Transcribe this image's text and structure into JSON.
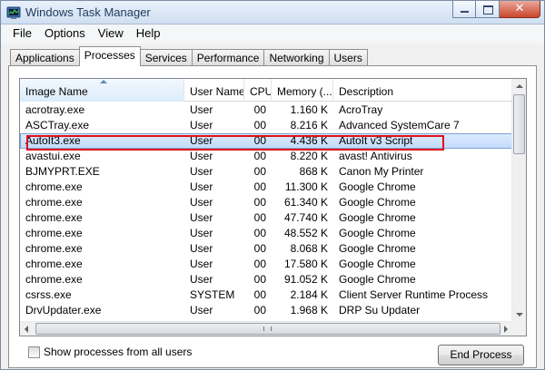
{
  "window": {
    "title": "Windows Task Manager",
    "icon": "task-manager-icon"
  },
  "menu": [
    "File",
    "Options",
    "View",
    "Help"
  ],
  "tabs": [
    {
      "label": "Applications",
      "active": false
    },
    {
      "label": "Processes",
      "active": true
    },
    {
      "label": "Services",
      "active": false
    },
    {
      "label": "Performance",
      "active": false
    },
    {
      "label": "Networking",
      "active": false
    },
    {
      "label": "Users",
      "active": false
    }
  ],
  "table": {
    "columns": [
      "Image Name",
      "User Name",
      "CPU",
      "Memory (...",
      "Description"
    ],
    "sorted_column": "Image Name",
    "rows": [
      [
        "acrotray.exe",
        "User",
        "00",
        "1.160 K",
        "AcroTray"
      ],
      [
        "ASCTray.exe",
        "User",
        "00",
        "8.216 K",
        "Advanced SystemCare 7"
      ],
      [
        "AutoIt3.exe",
        "User",
        "00",
        "4.436 K",
        "AutoIt v3 Script"
      ],
      [
        "avastui.exe",
        "User",
        "00",
        "8.220 K",
        "avast! Antivirus"
      ],
      [
        "BJMYPRT.EXE",
        "User",
        "00",
        "868 K",
        "Canon My Printer"
      ],
      [
        "chrome.exe",
        "User",
        "00",
        "11.300 K",
        "Google Chrome"
      ],
      [
        "chrome.exe",
        "User",
        "00",
        "61.340 K",
        "Google Chrome"
      ],
      [
        "chrome.exe",
        "User",
        "00",
        "47.740 K",
        "Google Chrome"
      ],
      [
        "chrome.exe",
        "User",
        "00",
        "48.552 K",
        "Google Chrome"
      ],
      [
        "chrome.exe",
        "User",
        "00",
        "8.068 K",
        "Google Chrome"
      ],
      [
        "chrome.exe",
        "User",
        "00",
        "17.580 K",
        "Google Chrome"
      ],
      [
        "chrome.exe",
        "User",
        "00",
        "91.052 K",
        "Google Chrome"
      ],
      [
        "csrss.exe",
        "SYSTEM",
        "00",
        "2.184 K",
        "Client Server Runtime Process"
      ],
      [
        "DrvUpdater.exe",
        "User",
        "00",
        "1.968 K",
        "DRP Su Updater"
      ]
    ],
    "selected_row": 2,
    "highlight_color": "#e1101a"
  },
  "footer": {
    "show_all_label": "Show processes from all users",
    "show_all_checked": false,
    "end_process_label": "End Process"
  }
}
